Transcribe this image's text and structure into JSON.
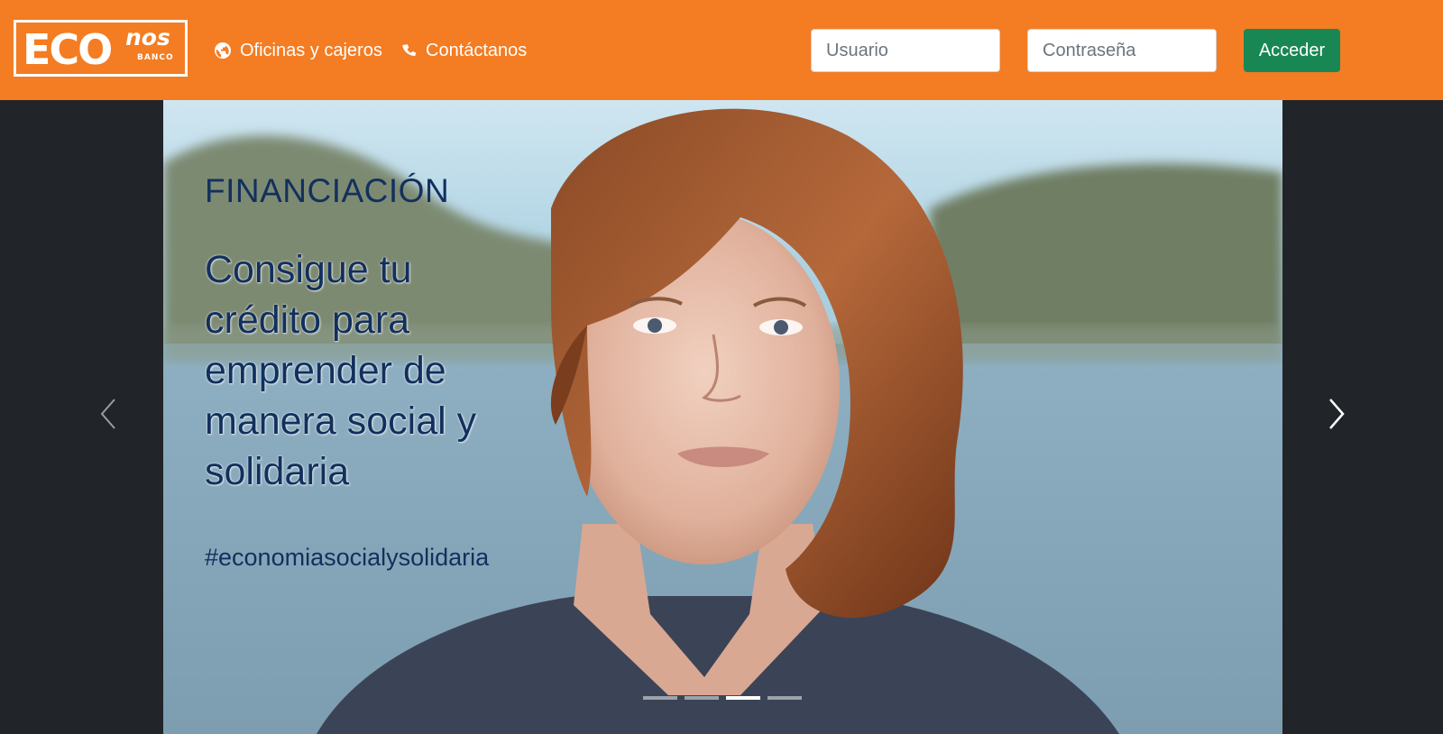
{
  "brand": {
    "logo_eco": "ECO",
    "logo_nos": "nos",
    "logo_banco": "BANCO"
  },
  "nav": {
    "items": [
      {
        "label": "Oficinas y cajeros",
        "icon": "globe-icon"
      },
      {
        "label": "Contáctanos",
        "icon": "phone-icon"
      }
    ]
  },
  "login": {
    "username_placeholder": "Usuario",
    "username_value": "",
    "password_placeholder": "Contraseña",
    "password_value": "",
    "submit_label": "Acceder"
  },
  "carousel": {
    "kicker": "FINANCIACIÓN",
    "headline": "Consigue tu crédito para emprender de manera social y solidaria",
    "hashtag": "#economiasocialysolidaria",
    "slide_count": 4,
    "active_index": 2,
    "prev_icon": "chevron-left-icon",
    "next_icon": "chevron-right-icon"
  },
  "colors": {
    "navbar": "#f47c22",
    "login_button": "#198754",
    "page_background": "#212529",
    "slide_text": "#12305e"
  }
}
